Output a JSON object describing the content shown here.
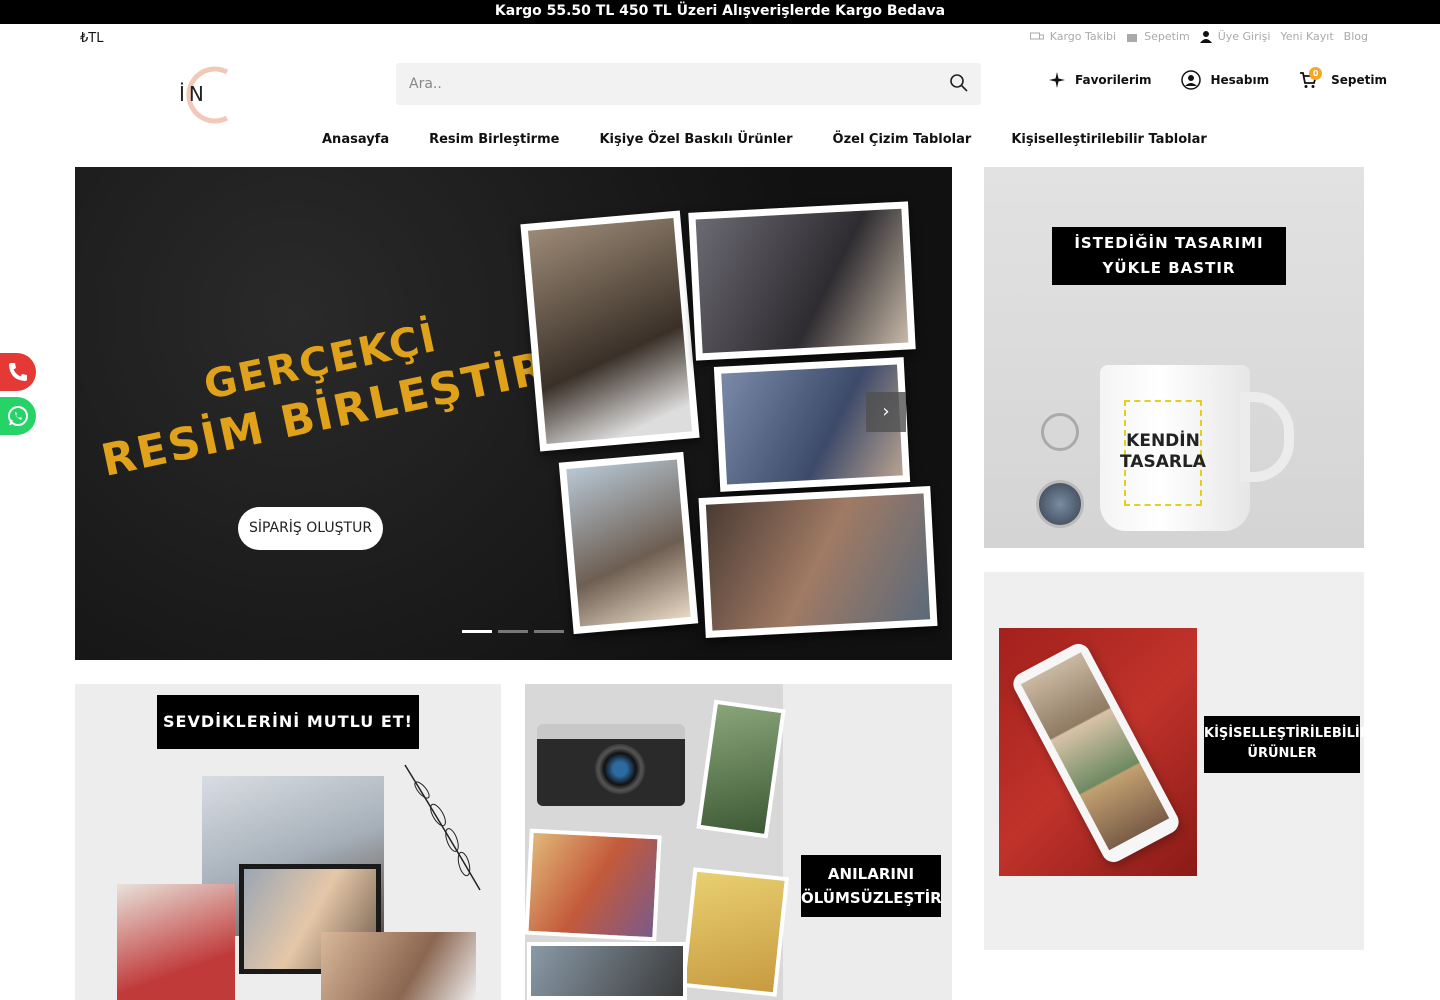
{
  "topbar": {
    "text": "Kargo 55.50 TL 450 TL Üzeri Alışverişlerde Kargo Bedava"
  },
  "currency": {
    "label": "₺TL"
  },
  "utility": {
    "items": [
      {
        "label": "Kargo Takibi",
        "icon": "truck-icon"
      },
      {
        "label": "Sepetim",
        "icon": "bag-icon"
      },
      {
        "label": "Üye Girişi",
        "icon": "user-icon"
      },
      {
        "label": "Yeni Kayıt"
      },
      {
        "label": "Blog"
      }
    ]
  },
  "logo": {
    "letters": "İN"
  },
  "search": {
    "placeholder": "Ara.."
  },
  "actions": {
    "favorites": "Favorilerim",
    "account": "Hesabım",
    "cart": "Sepetim",
    "cart_count": "0"
  },
  "nav": {
    "items": [
      "Anasayfa",
      "Resim Birleştirme",
      "Kişiye Özel Baskılı Ürünler",
      "Özel Çizim Tablolar",
      "Kişiselleştirilebilir Tablolar"
    ]
  },
  "hero": {
    "title_line1": "GERÇEKÇİ",
    "title_line2": "RESİM BİRLEŞTİRME",
    "cta": "SİPARİŞ OLUŞTUR",
    "next": "›"
  },
  "banners": {
    "design": {
      "title": "İSTEDİĞİN TASARIMI YÜKLE BASTIR",
      "mug_text": "KENDİN TASARLA"
    },
    "happy": {
      "title": "SEVDİKLERİNİ MUTLU ET!"
    },
    "memories": {
      "title": "ANILARINI ÖLÜMSÜZLEŞTİR"
    },
    "custom": {
      "title": "KİŞİSELLEŞTİRİLEBİLİR ÜRÜNLER"
    }
  },
  "colors": {
    "accent": "#e0a21b",
    "topbar": "#000000",
    "phone": "#e53935",
    "whatsapp": "#25d366"
  }
}
